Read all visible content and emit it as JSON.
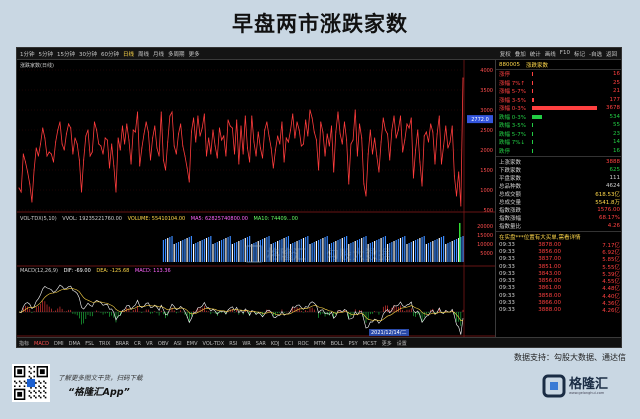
{
  "page": {
    "title": "早盘两市涨跌家数"
  },
  "toolbar": {
    "left": [
      "1分钟",
      "5分钟",
      "15分钟",
      "30分钟",
      "60分钟",
      "日线",
      "周线",
      "月线",
      "多周期",
      "更多"
    ],
    "active_index": 5,
    "right": [
      "复权",
      "叠加",
      "统计",
      "画线",
      "F10",
      "标记",
      "-自选",
      "返回"
    ]
  },
  "chart": {
    "main_label": "涨跌家数(日线)",
    "y_ticks": [
      "4000",
      "3500",
      "3000",
      "2500",
      "2000",
      "1500",
      "1000",
      "500"
    ],
    "last_value": "2772.0",
    "last_y_value": 2772,
    "series": [
      1050,
      950,
      1900,
      1700,
      1450,
      1150,
      700,
      1500,
      2050,
      1850,
      2150,
      2550,
      2300,
      1850,
      1950,
      1900,
      1700,
      2200,
      2500,
      2700,
      2150,
      2000,
      2400,
      2650,
      2550,
      1900,
      2300,
      2150,
      1750,
      950,
      1750,
      2350,
      2500,
      1850,
      1950,
      2700,
      2500,
      2150,
      2100,
      1900,
      2300,
      2250,
      1550,
      2150,
      1600,
      950,
      2300,
      2000,
      2600,
      2150,
      2650,
      2250,
      1650,
      2500,
      2450,
      2950,
      1600,
      2050,
      2400,
      2700,
      2450,
      1750,
      2300,
      2600,
      2050,
      1850,
      2950,
      1750,
      1500,
      2200,
      2850,
      2950,
      2100,
      1900,
      2400,
      2650,
      2100,
      1850,
      1550,
      1200,
      2450,
      2800,
      2200,
      2850,
      2350,
      2550,
      2900,
      1850,
      2300,
      1900,
      2500,
      2100,
      1800,
      2550,
      2250,
      2350,
      1850,
      2750,
      2600,
      2550,
      1900,
      2750,
      1650,
      2600,
      1900,
      2850,
      2050,
      1700,
      2850,
      2200,
      1850,
      2450,
      2050,
      1800,
      2500,
      2700,
      2350,
      2050,
      1550,
      2000,
      2350,
      2150,
      2700,
      1700,
      2300,
      2200,
      2500,
      2900,
      2300,
      2700,
      2500,
      2100,
      2150,
      2750,
      2350,
      3000,
      2800,
      2450,
      2250,
      1500,
      2700,
      2450,
      1850,
      2400,
      2100,
      2600,
      1450,
      2450,
      2950,
      2400,
      2150,
      2700,
      2250,
      1150,
      2150,
      2250,
      3000,
      1850,
      2650,
      2300,
      1150,
      850,
      1900,
      2500,
      1900,
      2300,
      1850,
      1450,
      2200,
      2800,
      2500,
      2400,
      1750,
      2500,
      2850,
      2300,
      2500,
      2850,
      1950,
      2250,
      2650,
      2550,
      2800,
      1300,
      2000,
      2500,
      1700,
      1100,
      2350,
      2450,
      2200,
      2650,
      2450,
      1650,
      2400,
      2850,
      1650,
      2100,
      2600,
      2050,
      2200,
      2600,
      1350,
      850,
      1450,
      600,
      3800
    ],
    "vol_info": {
      "label": "VOL-TDX(5,10)",
      "items": [
        "VVOL: 19235221760.00",
        "VOLUME: 55410104.00",
        "MA5: 62825740800.00",
        "MA10: 74409...00"
      ]
    },
    "vol_ticks": [
      "20000",
      "15000",
      "10000",
      "5000"
    ],
    "macd_info": {
      "label": "MACD(12,26,9)",
      "items": [
        "DIF: -69.00",
        "DEA: -125.68",
        "MACD: 113.36"
      ]
    },
    "date_label": "2021/12/14/二",
    "watermark": {
      "brand": "格隆汇",
      "partner": "勾股大数据"
    }
  },
  "tabs": [
    "指标",
    "MACD",
    "DMI",
    "DMA",
    "FSL",
    "TRIX",
    "BRAR",
    "CR",
    "VR",
    "OBV",
    "ASI",
    "EMV",
    "VOL-TDX",
    "RSI",
    "WR",
    "SAR",
    "KDJ",
    "CCI",
    "ROC",
    "MTM",
    "BOLL",
    "PSY",
    "MCST",
    "更多",
    "设置"
  ],
  "right_panel": {
    "code": "880005",
    "name": "涨跌家数",
    "distribution": [
      {
        "label": "涨停",
        "value": "16",
        "pct": 0.5,
        "color": "#ff4040"
      },
      {
        "label": "涨幅 7%↑",
        "value": "25",
        "pct": 0.7,
        "color": "#ff4040"
      },
      {
        "label": "涨幅 5-7%",
        "value": "21",
        "pct": 0.6,
        "color": "#ff4040"
      },
      {
        "label": "涨幅 3-5%",
        "value": "177",
        "pct": 3,
        "color": "#ff4040"
      },
      {
        "label": "涨幅 0-3%",
        "value": "3678",
        "pct": 100,
        "color": "#ff4040"
      },
      {
        "label": "跌幅 0-3%",
        "value": "534",
        "pct": 15,
        "color": "#22cc44"
      },
      {
        "label": "跌幅 3-5%",
        "value": "55",
        "pct": 1.5,
        "color": "#22cc44"
      },
      {
        "label": "跌幅 5-7%",
        "value": "23",
        "pct": 0.7,
        "color": "#22cc44"
      },
      {
        "label": "跌幅 7%↓",
        "value": "14",
        "pct": 0.5,
        "color": "#22cc44"
      },
      {
        "label": "跌停",
        "value": "16",
        "pct": 0.5,
        "color": "#22cc44"
      }
    ],
    "stats": [
      {
        "label": "上涨家数",
        "value": "3888",
        "color": "#ff4040"
      },
      {
        "label": "下跌家数",
        "value": "625",
        "color": "#22cc44"
      },
      {
        "label": "平盘家数",
        "value": "111",
        "color": "#d0d0d0"
      },
      {
        "label": "总品种数",
        "value": "4624",
        "color": "#d0d0d0"
      },
      {
        "label": "总成交额",
        "value": "618.53亿",
        "color": "#ffd84a"
      },
      {
        "label": "总成交量",
        "value": "5541.8万",
        "color": "#ffd84a"
      },
      {
        "label": "指数涨跌",
        "value": "1576.00",
        "color": "#ff4040"
      },
      {
        "label": "指数涨幅",
        "value": "68.17%",
        "color": "#ff4040"
      },
      {
        "label": "指数量比",
        "value": "4.26",
        "color": "#ff4040"
      }
    ],
    "ticks_header": "在实盘***位置有大买单,需看详情",
    "ticks": [
      {
        "time": "09:33",
        "value": "3878.00",
        "pct": "7.17亿"
      },
      {
        "time": "09:33",
        "value": "3856.00",
        "pct": "6.92亿"
      },
      {
        "time": "09:33",
        "value": "3837.00",
        "pct": "5.85亿"
      },
      {
        "time": "09:33",
        "value": "3851.00",
        "pct": "5.55亿"
      },
      {
        "time": "09:33",
        "value": "3843.00",
        "pct": "5.39亿"
      },
      {
        "time": "09:33",
        "value": "3856.00",
        "pct": "4.55亿"
      },
      {
        "time": "09:33",
        "value": "3861.00",
        "pct": "4.48亿"
      },
      {
        "time": "09:33",
        "value": "3858.00",
        "pct": "4.40亿"
      },
      {
        "time": "09:33",
        "value": "3866.00",
        "pct": "4.36亿"
      },
      {
        "time": "09:33",
        "value": "3888.00",
        "pct": "4.26亿"
      }
    ]
  },
  "source_text": "数据支持：勾股大数据、通达信",
  "footer": {
    "tip": "了解更多图文干货，扫码下载",
    "app": "“格隆汇App”",
    "brand": "格隆汇",
    "brand_url": "www.gelonghui.com"
  },
  "colors": {
    "line": "#ff3c3c",
    "vol_bar": "#3b8bff",
    "panel_bg": "#c9d7e3"
  }
}
